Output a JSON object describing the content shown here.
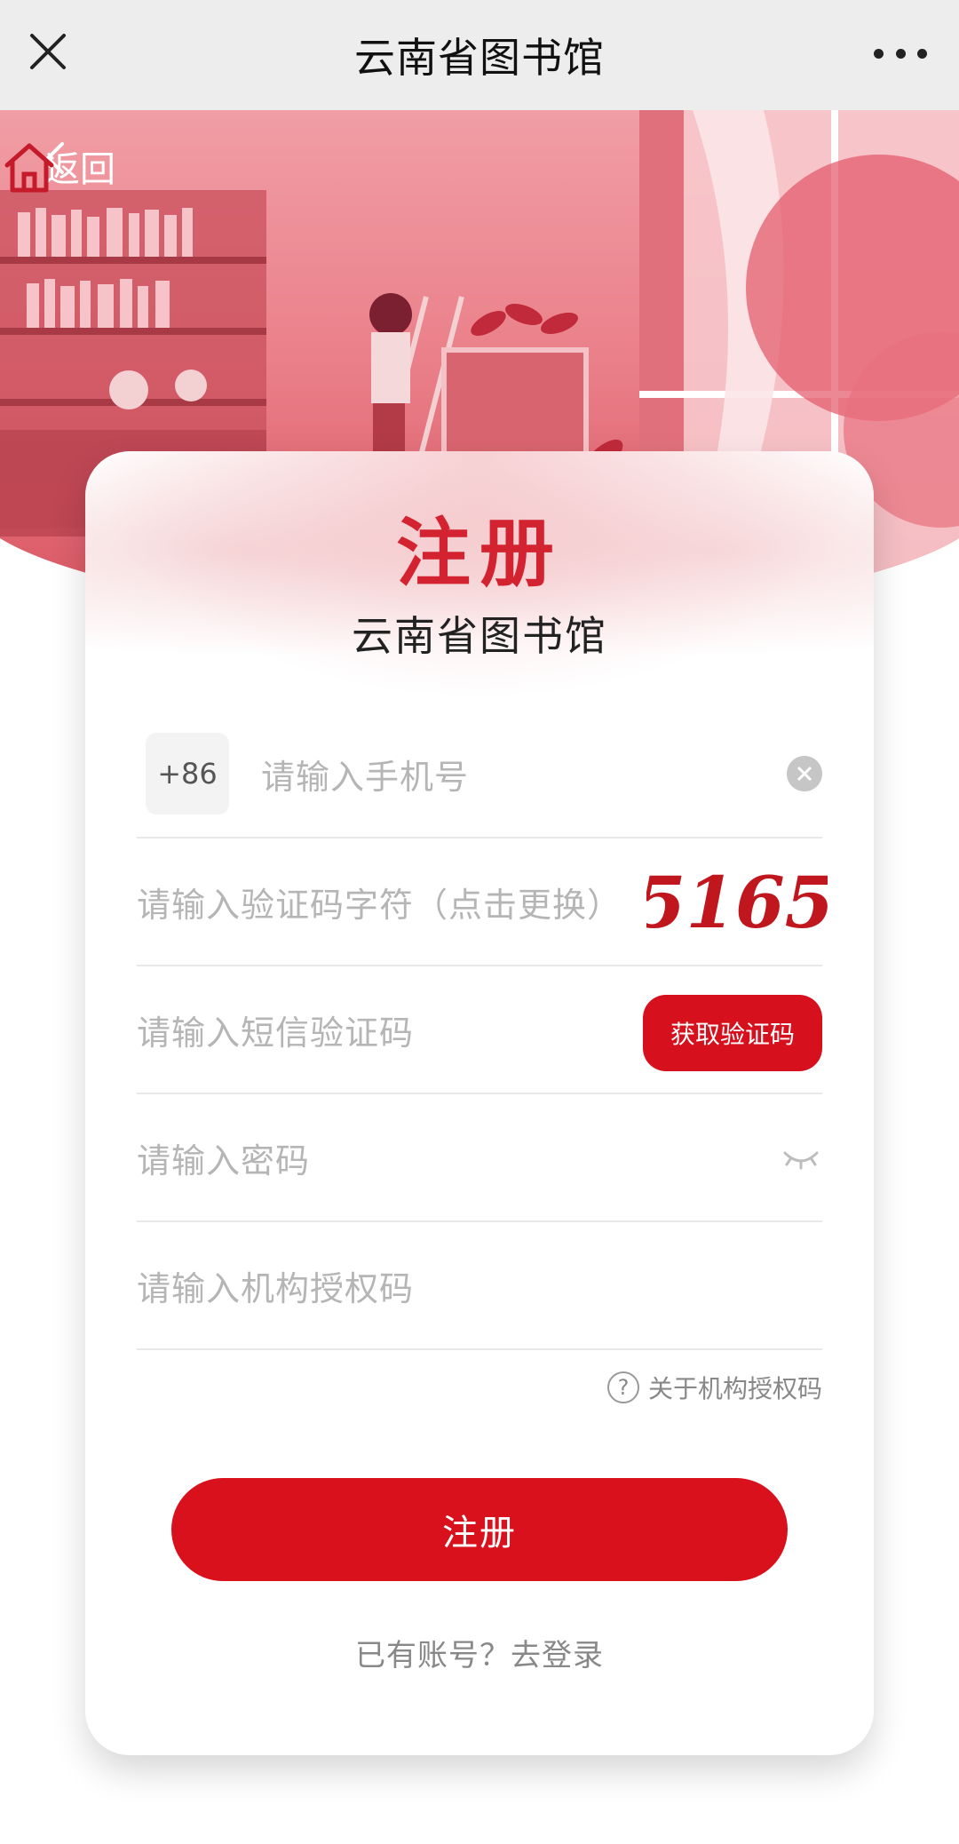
{
  "topbar": {
    "title": "云南省图书馆",
    "close_icon": "close-icon",
    "more_icon": "more-icon"
  },
  "hero": {
    "back_label": "返回",
    "home_icon": "home-icon"
  },
  "card": {
    "heading": "注册",
    "subheading": "云南省图书馆"
  },
  "form": {
    "country_code": "+86",
    "phone_placeholder": "请输入手机号",
    "captcha_placeholder": "请输入验证码字符（点击更换）",
    "captcha_text": "5165",
    "sms_placeholder": "请输入短信验证码",
    "sms_button": "获取验证码",
    "password_placeholder": "请输入密码",
    "auth_placeholder": "请输入机构授权码",
    "about_auth": "关于机构授权码",
    "submit": "注册",
    "login_prefix": "已有账号？",
    "login_link": "去登录"
  },
  "colors": {
    "accent": "#d6101c",
    "title_red": "#d42330",
    "topbar_bg": "#ededed"
  }
}
